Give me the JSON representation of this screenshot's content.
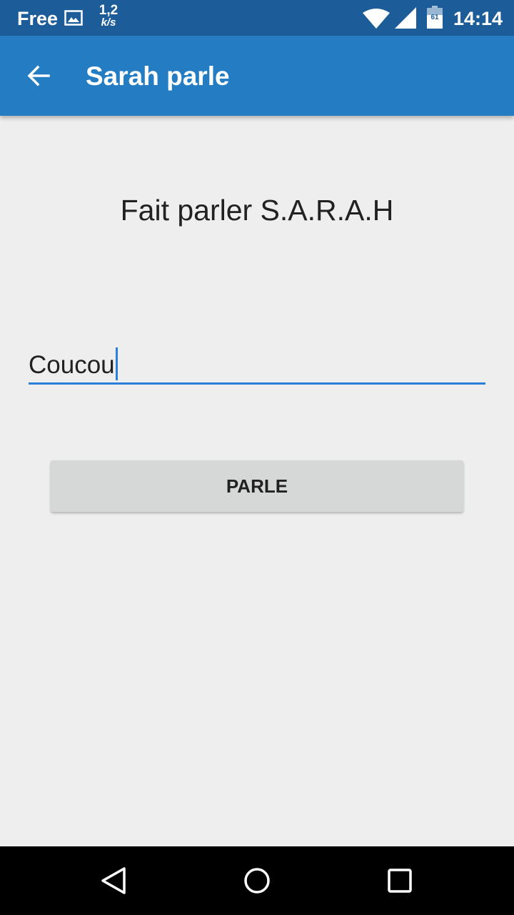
{
  "status_bar": {
    "carrier": "Free",
    "speed_value": "1,2",
    "speed_unit": "k/s",
    "battery_level": "61",
    "time": "14:14",
    "icons": [
      "image-icon",
      "wifi-icon",
      "signal-icon",
      "battery-icon"
    ]
  },
  "app_bar": {
    "title": "Sarah parle",
    "back_icon": "arrow-back-icon",
    "color": "#247cc3"
  },
  "main": {
    "heading": "Fait parler S.A.R.A.H",
    "input_value": "Coucou",
    "button_label": "PARLE",
    "accent_color": "#2a7fd9"
  },
  "nav_bar": {
    "icons": [
      "nav-back-icon",
      "nav-home-icon",
      "nav-recents-icon"
    ]
  }
}
